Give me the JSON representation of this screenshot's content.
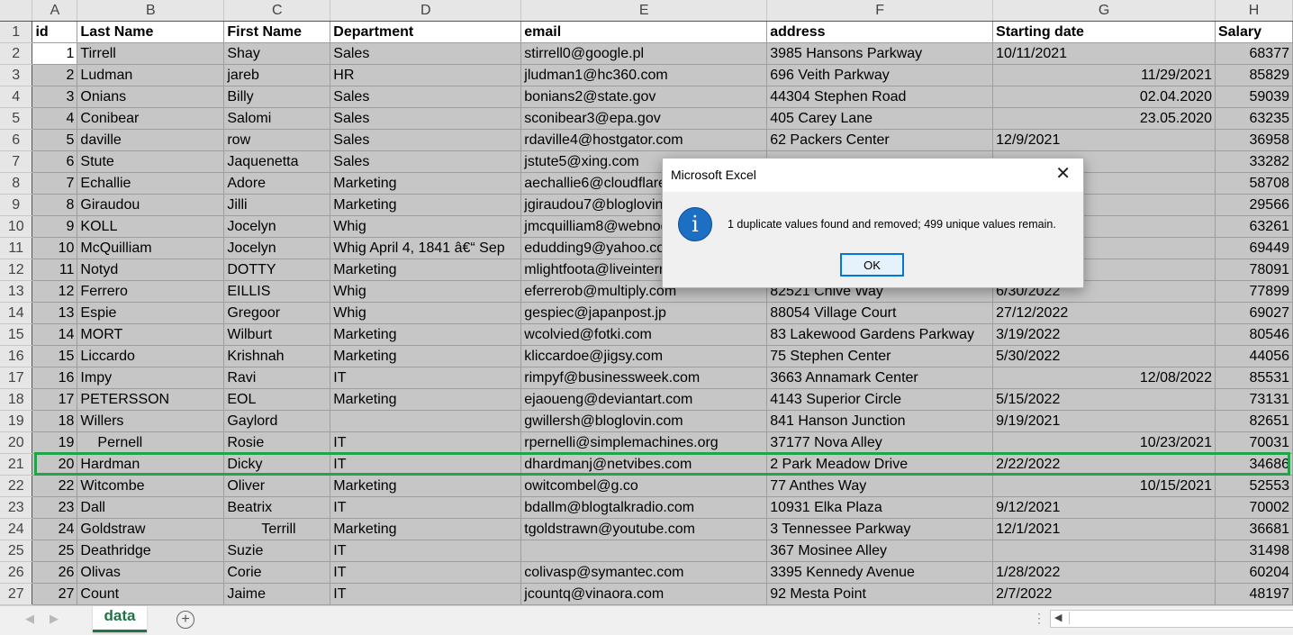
{
  "columns": [
    "A",
    "B",
    "C",
    "D",
    "E",
    "F",
    "G",
    "H"
  ],
  "headers": [
    "id",
    "Last Name",
    "First Name",
    "Department",
    "email",
    "address",
    "Starting date",
    "Salary"
  ],
  "rows": [
    {
      "n": "2",
      "cells": [
        "1",
        "Tirrell",
        "Shay",
        "Sales",
        "stirrell0@google.pl",
        "3985 Hansons Parkway",
        "10/11/2021",
        "68377"
      ]
    },
    {
      "n": "3",
      "cells": [
        "2",
        "Ludman",
        "jareb",
        "HR",
        "jludman1@hc360.com",
        "696 Veith Parkway",
        "11/29/2021",
        "85829"
      ]
    },
    {
      "n": "4",
      "cells": [
        "3",
        "Onians",
        "Billy",
        "Sales",
        "bonians2@state.gov",
        "44304 Stephen Road",
        "02.04.2020",
        "59039"
      ]
    },
    {
      "n": "5",
      "cells": [
        "4",
        "Conibear",
        "Salomi",
        "Sales",
        "sconibear3@epa.gov",
        "405 Carey Lane",
        "23.05.2020",
        "63235"
      ]
    },
    {
      "n": "6",
      "cells": [
        "5",
        "daville",
        "row",
        "Sales",
        "rdaville4@hostgator.com",
        "62 Packers Center",
        "12/9/2021",
        "36958"
      ]
    },
    {
      "n": "7",
      "cells": [
        "6",
        "Stute",
        "Jaquenetta",
        "Sales",
        "jstute5@xing.com",
        "",
        "",
        "33282"
      ]
    },
    {
      "n": "8",
      "cells": [
        "7",
        "Echallie",
        "Adore",
        "Marketing",
        "aechallie6@cloudflare.com",
        "",
        "",
        "58708"
      ]
    },
    {
      "n": "9",
      "cells": [
        "8",
        "Giraudou",
        "Jilli",
        "Marketing",
        "jgiraudou7@bloglovin.com",
        "",
        "",
        "29566"
      ]
    },
    {
      "n": "10",
      "cells": [
        "9",
        "KOLL",
        "Jocelyn",
        "Whig",
        "jmcquilliam8@webnode.com",
        "",
        "",
        "63261"
      ]
    },
    {
      "n": "11",
      "cells": [
        "10",
        "McQuilliam",
        "Jocelyn",
        "Whig   April 4, 1841  â€“ Sep",
        "edudding9@yahoo.com",
        "",
        "",
        "69449"
      ]
    },
    {
      "n": "12",
      "cells": [
        "11",
        "Notyd",
        "DOTTY",
        "Marketing",
        "mlightfoota@liveinternet.ru",
        "",
        "",
        "78091"
      ]
    },
    {
      "n": "13",
      "cells": [
        "12",
        "Ferrero",
        "EILLIS",
        "Whig",
        "eferrerob@multiply.com",
        "82521 Chive Way",
        "6/30/2022",
        "77899"
      ]
    },
    {
      "n": "14",
      "cells": [
        "13",
        "Espie",
        "Gregoor",
        "Whig",
        "gespiec@japanpost.jp",
        "88054 Village Court",
        "27/12/2022",
        "69027"
      ]
    },
    {
      "n": "15",
      "cells": [
        "14",
        "MORT",
        "Wilburt",
        "Marketing",
        "wcolvied@fotki.com",
        "83 Lakewood Gardens Parkway",
        "3/19/2022",
        "80546"
      ]
    },
    {
      "n": "16",
      "cells": [
        "15",
        "Liccardo",
        "Krishnah",
        "Marketing",
        "kliccardoe@jigsy.com",
        "75 Stephen Center",
        "5/30/2022",
        "44056"
      ]
    },
    {
      "n": "17",
      "cells": [
        "16",
        "Impy",
        "Ravi",
        "IT",
        "rimpyf@businessweek.com",
        "3663 Annamark Center",
        "12/08/2022",
        "85531"
      ]
    },
    {
      "n": "18",
      "cells": [
        "17",
        "PETERSSON",
        "EOL",
        "Marketing",
        "ejaoueng@deviantart.com",
        "4143 Superior Circle",
        "5/15/2022",
        "73131"
      ]
    },
    {
      "n": "19",
      "cells": [
        "18",
        "Willers",
        "Gaylord",
        "",
        "gwillersh@bloglovin.com",
        "841 Hanson Junction",
        "9/19/2021",
        "82651"
      ]
    },
    {
      "n": "20",
      "cells": [
        "19",
        "Pernell",
        "Rosie",
        "IT",
        "rpernelli@simplemachines.org",
        "37177 Nova Alley",
        "10/23/2021",
        "70031"
      ]
    },
    {
      "n": "21",
      "cells": [
        "20",
        "Hardman",
        "Dicky",
        "IT",
        "dhardmanj@netvibes.com",
        "2 Park Meadow Drive",
        "2/22/2022",
        "34686"
      ]
    },
    {
      "n": "22",
      "cells": [
        "22",
        "Witcombe",
        "Oliver",
        "Marketing",
        "owitcombel@g.co",
        "77 Anthes Way",
        "10/15/2021",
        "52553"
      ]
    },
    {
      "n": "23",
      "cells": [
        "23",
        "Dall",
        "Beatrix",
        "IT",
        "bdallm@blogtalkradio.com",
        "10931 Elka Plaza",
        "9/12/2021",
        "70002"
      ]
    },
    {
      "n": "24",
      "cells": [
        "24",
        "Goldstraw",
        "Terrill",
        "Marketing",
        "tgoldstrawn@youtube.com",
        "3 Tennessee Parkway",
        "12/1/2021",
        "36681"
      ]
    },
    {
      "n": "25",
      "cells": [
        "25",
        "Deathridge",
        "Suzie",
        "IT",
        "",
        "367 Mosinee Alley",
        "",
        "31498"
      ]
    },
    {
      "n": "26",
      "cells": [
        "26",
        "Olivas",
        "Corie",
        "IT",
        "colivasp@symantec.com",
        "3395 Kennedy Avenue",
        "1/28/2022",
        "60204"
      ]
    },
    {
      "n": "27",
      "cells": [
        "27",
        "Count",
        "Jaime",
        "IT",
        "jcountq@vinaora.com",
        "92 Mesta Point",
        "2/7/2022",
        "48197"
      ]
    }
  ],
  "sheet_tab": "data",
  "add_sheet_symbol": "+",
  "dialog": {
    "title": "Microsoft Excel",
    "close_symbol": "✕",
    "info_symbol": "i",
    "message": "1 duplicate values found and removed; 499 unique values remain.",
    "ok_label": "OK"
  }
}
